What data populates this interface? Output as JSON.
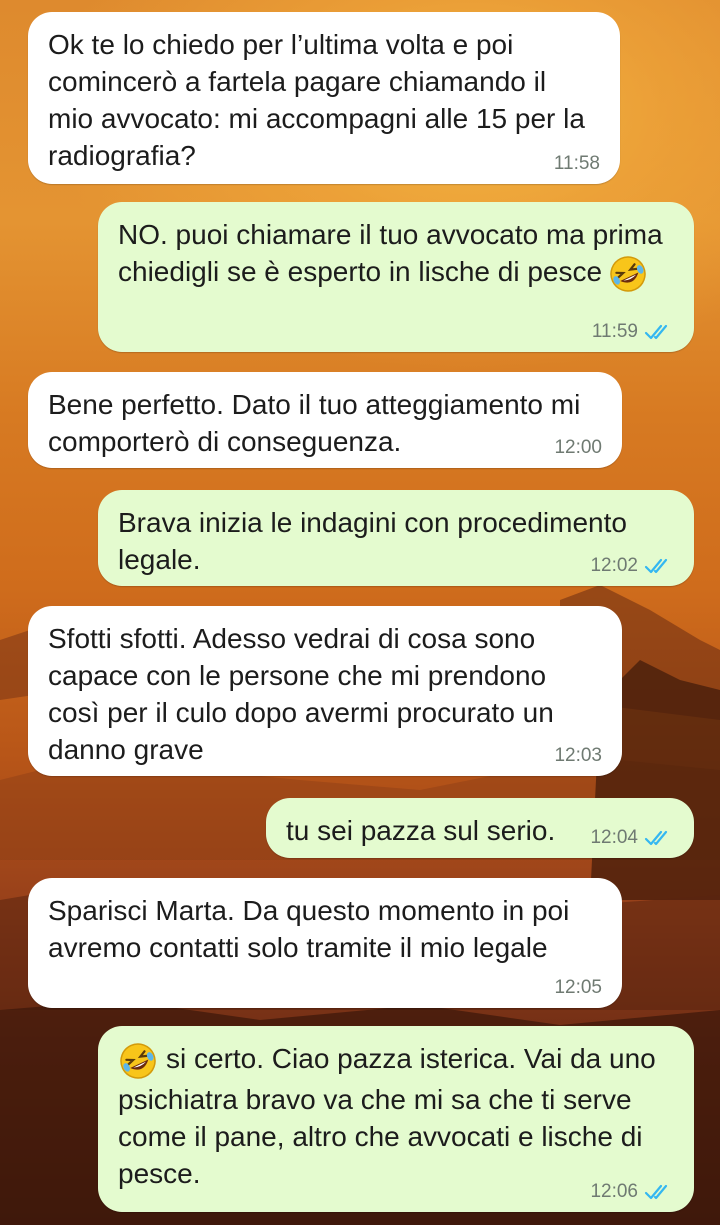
{
  "background": {
    "name": "sunset-wallpaper",
    "colors": [
      "#e49432",
      "#cf6c1c",
      "#4a1d0e"
    ]
  },
  "colors": {
    "incoming_bubble": "#ffffff",
    "outgoing_bubble": "#e4fbcf",
    "read_ticks": "#34b7f1",
    "time": "#6f7a72"
  },
  "messages": [
    {
      "direction": "incoming",
      "text": "Ok te lo chiedo per l’ultima volta e poi comincerò a fartela pagare chiamando il mio avvocato: mi accompagni alle 15 per la radiografia?",
      "time": "11:58"
    },
    {
      "direction": "outgoing",
      "text": "NO. puoi chiamare il tuo avvocato ma prima chiedigli se è esperto in lische di pesce",
      "emoji": "rolling-on-floor-laughing-emoji",
      "time": "11:59",
      "status": "read"
    },
    {
      "direction": "incoming",
      "text": "Bene perfetto. Dato il tuo atteggiamento mi comporterò di conseguenza.",
      "time": "12:00"
    },
    {
      "direction": "outgoing",
      "text": "Brava inizia le indagini con procedimento legale.",
      "time": "12:02",
      "status": "read"
    },
    {
      "direction": "incoming",
      "text": "Sfotti sfotti. Adesso vedrai di cosa sono capace con le persone che mi prendono così per il culo dopo avermi procurato un danno grave",
      "time": "12:03"
    },
    {
      "direction": "outgoing",
      "text": "tu sei pazza sul serio.",
      "time": "12:04",
      "status": "read"
    },
    {
      "direction": "incoming",
      "text": "Sparisci Marta. Da questo momento in poi avremo contatti solo tramite il mio legale",
      "time": "12:05"
    },
    {
      "direction": "outgoing",
      "text": "si certo. Ciao pazza isterica. Vai da uno psichiatra bravo va che mi sa che ti serve come il pane, altro che avvocati e lische di pesce.",
      "emoji": "rolling-on-floor-laughing-emoji",
      "time": "12:06",
      "status": "read"
    }
  ]
}
